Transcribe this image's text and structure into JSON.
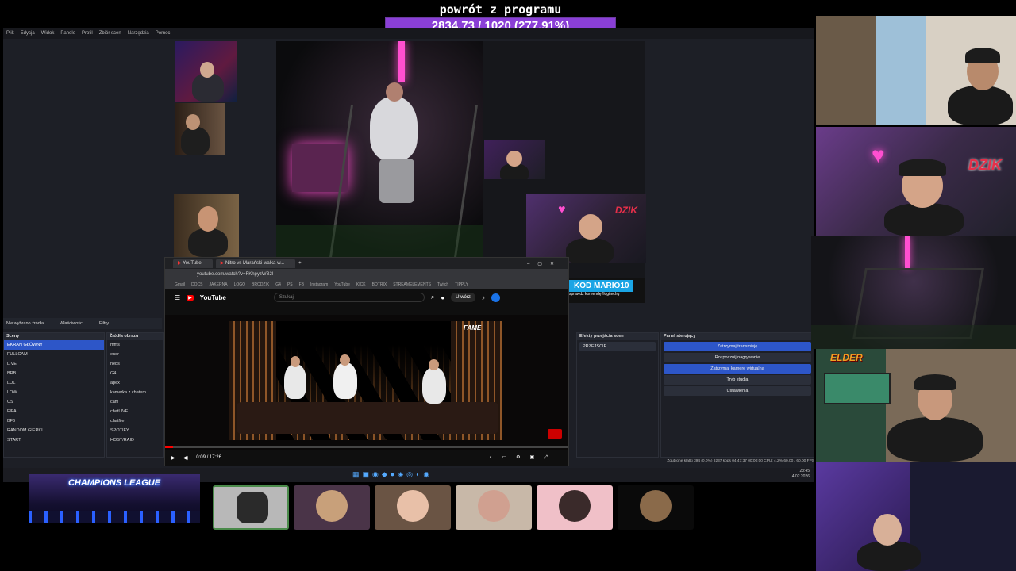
{
  "overlay": {
    "title": "powrót z programu",
    "progress_text": "2834.73 / 1020 (277.91%)",
    "progress_fraction": 1.0,
    "accent": "#8a3fd6"
  },
  "obs": {
    "menu": [
      "Plik",
      "Edycja",
      "Widok",
      "Panele",
      "Profil",
      "Zbiór scen",
      "Narzędzia",
      "Pomoc"
    ],
    "no_source": "Nie wybrano źródła",
    "properties": "Właściwości",
    "filters": "Filtry",
    "scenes_header": "Sceny",
    "scenes": [
      "EKRAN GŁÓWNY",
      "FULLCAM",
      "LIVE",
      "BRB",
      "LOL",
      "LOW",
      "CS",
      "FIFA",
      "BF6",
      "RANDOM GIERKI",
      "START"
    ],
    "sources_header": "Źródła obrazu",
    "sources": [
      "mms",
      "endr",
      "nebs",
      "G4",
      "apex",
      "kamerka z chatem",
      "cam",
      "chatLIVE",
      "chatfile",
      "SPOTIFY",
      "HOST/RAID"
    ],
    "transitions_header": "Efekty przejścia scen",
    "transition_value": "PRZEJŚCIE",
    "controls_header": "Panel sterujący",
    "controls": [
      "Zatrzymaj transmisję",
      "Rozpocznij nagrywanie",
      "Zatrzymaj kamerę wirtualną",
      "Tryb studia",
      "Ustawienia"
    ],
    "status": "Zgubione klatki 394 (0.0%)   8237 kbps   04:47:37   00:00:00   CPU: 4.2%   60.00 / 60.00 FPS",
    "clock": "23:45",
    "date": "4.02.2026"
  },
  "browser": {
    "tabs": [
      "YouTube",
      "Nitro vs Marański walka w..."
    ],
    "url": "youtube.com/watch?v=FKhpyzWB2I",
    "bookmarks": [
      "Gmail",
      "DOCS",
      "JAKERNA",
      "LOGO",
      "BRODZIK",
      "G4",
      "PS",
      "FB",
      "Instagram",
      "YouTube",
      "KICK",
      "BOTRIX",
      "STREAMELEMENTS",
      "Twitch",
      "TIPPLY"
    ],
    "search_placeholder": "Szukaj",
    "create_label": "Utwórz",
    "video_time": "0:09 / 17:26",
    "brand_badge": "FAME",
    "logo": "YouTube"
  },
  "stream": {
    "kod_label": "KOD MARIO10",
    "kod_sub": "sprawdź komendę !logitechg",
    "dzik": "DZIK",
    "elder": "ELDER",
    "champions": "CHAMPIONS LEAGUE"
  }
}
